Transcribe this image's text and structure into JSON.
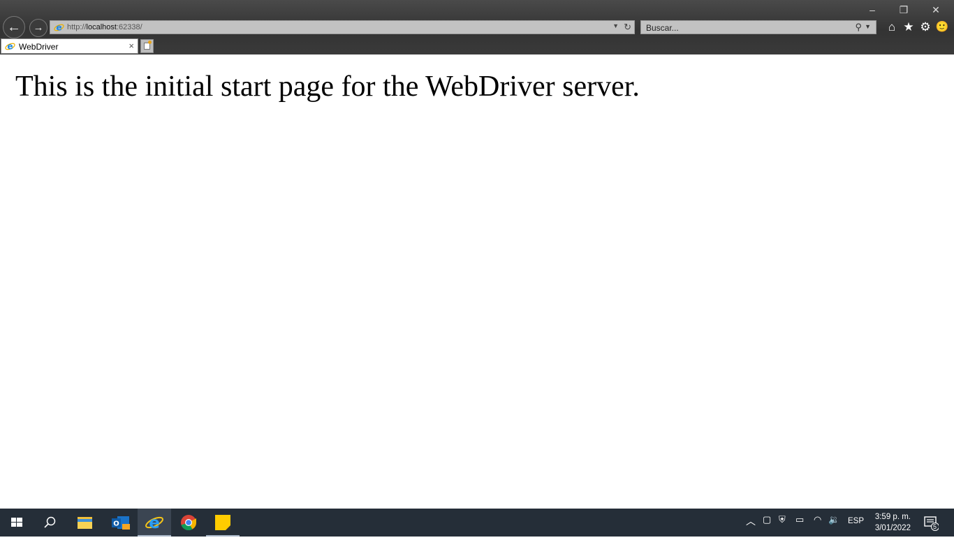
{
  "window": {
    "minimize_label": "–",
    "restore_label": "❐",
    "close_label": "✕"
  },
  "toolbar": {
    "back_label": "←",
    "forward_label": "→",
    "address": {
      "scheme": "http://",
      "host": "localhost",
      "port_path": ":62338/"
    },
    "search_placeholder": "Buscar...",
    "home_label": "⌂",
    "favorites_label": "★",
    "tools_label": "⚙",
    "feedback_label": "🙂"
  },
  "tabs": [
    {
      "title": "WebDriver",
      "close_label": "×"
    }
  ],
  "page": {
    "heading": "This is the initial start page for the WebDriver server."
  },
  "taskbar": {
    "apps": [
      "start",
      "search",
      "file-explorer",
      "outlook",
      "internet-explorer",
      "chrome",
      "sticky-notes"
    ],
    "language": "ESP",
    "time": "3:59 p. m.",
    "date": "3/01/2022",
    "notifications_count": "5"
  }
}
